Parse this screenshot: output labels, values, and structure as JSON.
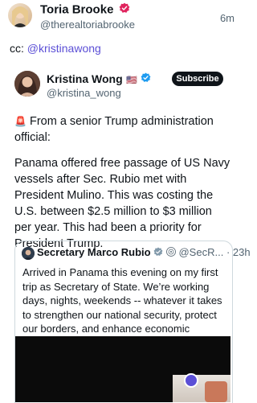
{
  "outer_post": {
    "author_name": "Toria Brooke",
    "author_handle": "@therealtoriabrooke",
    "time": "6m",
    "caption_prefix": "cc:",
    "caption_mention": "@kristinawong"
  },
  "embedded_post": {
    "author_name": "Kristina Wong",
    "flag": "🇺🇸",
    "author_handle": "@kristina_wong",
    "subscribe_label": "Subscribe",
    "alert_icon": "🚨",
    "paragraph1": "From a senior Trump administration official:",
    "paragraph2": "Panama offered free passage of US Navy vessels after Sec. Rubio met with President Mulino. This was costing the U.S. between $2.5 million to $3 million per year. This had been a priority for President Trump."
  },
  "quoted_post": {
    "author_name": "Secretary Marco Rubio",
    "author_handle": "@SecR...",
    "separator": "·",
    "time": "23h",
    "text": "Arrived in Panama this evening on my first trip as Secretary of State. We’re working days, nights, weekends -- whatever it takes to strengthen our national security, protect our borders, and enhance economic prosperity for Americans."
  },
  "colors": {
    "verified_blue": "#1d9bf0",
    "gold_badge": "#e8a317",
    "mention_link": "#5b4fd6",
    "toria_badge": "#e0245e"
  }
}
